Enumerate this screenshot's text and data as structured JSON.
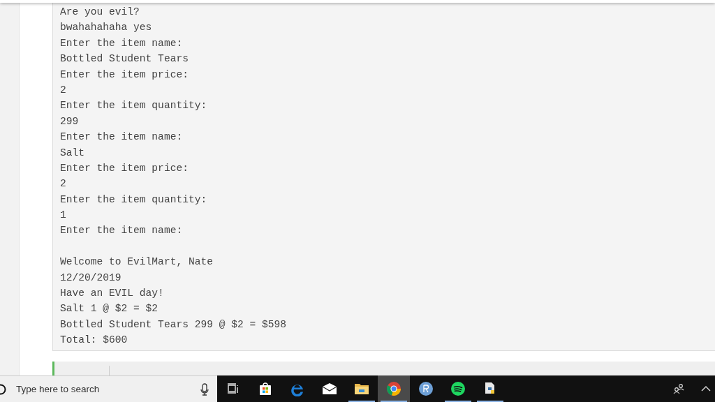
{
  "console": {
    "lines": [
      {
        "kind": "text",
        "text": "Are you evil?"
      },
      {
        "kind": "text",
        "text": "bwahahahaha yes"
      },
      {
        "kind": "text",
        "text": "Enter the item name:"
      },
      {
        "kind": "text",
        "text": "Bottled Student Tears"
      },
      {
        "kind": "text",
        "text": "Enter the item price:"
      },
      {
        "kind": "text",
        "text": "2"
      },
      {
        "kind": "text",
        "text": "Enter the item quantity:"
      },
      {
        "kind": "text",
        "text": "299"
      },
      {
        "kind": "text",
        "text": "Enter the item name:"
      },
      {
        "kind": "text",
        "text": "Salt"
      },
      {
        "kind": "text",
        "text": "Enter the item price:"
      },
      {
        "kind": "text",
        "text": "2"
      },
      {
        "kind": "text",
        "text": "Enter the item quantity:"
      },
      {
        "kind": "text",
        "text": "1"
      },
      {
        "kind": "text",
        "text": "Enter the item name:"
      },
      {
        "kind": "blank"
      },
      {
        "kind": "text",
        "text": "Welcome to EvilMart, Nate"
      },
      {
        "kind": "text",
        "text": "12/20/2019"
      },
      {
        "kind": "text",
        "text": "Have an EVIL day!"
      },
      {
        "kind": "text",
        "text": "Salt 1 @ $2 = $2"
      },
      {
        "kind": "text",
        "text": "Bottled Student Tears 299 @ $2 = $598"
      },
      {
        "kind": "text",
        "text": "Total: $600"
      }
    ]
  },
  "taskbar": {
    "search": {
      "placeholder": "Type here to search"
    },
    "apps": [
      {
        "kind": "taskview",
        "running": false,
        "selected": false
      },
      {
        "kind": "store",
        "running": false,
        "selected": false
      },
      {
        "kind": "edge",
        "running": false,
        "selected": false
      },
      {
        "kind": "mail",
        "running": false,
        "selected": false
      },
      {
        "kind": "explorer",
        "running": true,
        "selected": false
      },
      {
        "kind": "chrome",
        "running": true,
        "selected": true
      },
      {
        "kind": "r",
        "running": false,
        "selected": false
      },
      {
        "kind": "spotify",
        "running": true,
        "selected": false
      },
      {
        "kind": "python",
        "running": true,
        "selected": false
      }
    ]
  }
}
